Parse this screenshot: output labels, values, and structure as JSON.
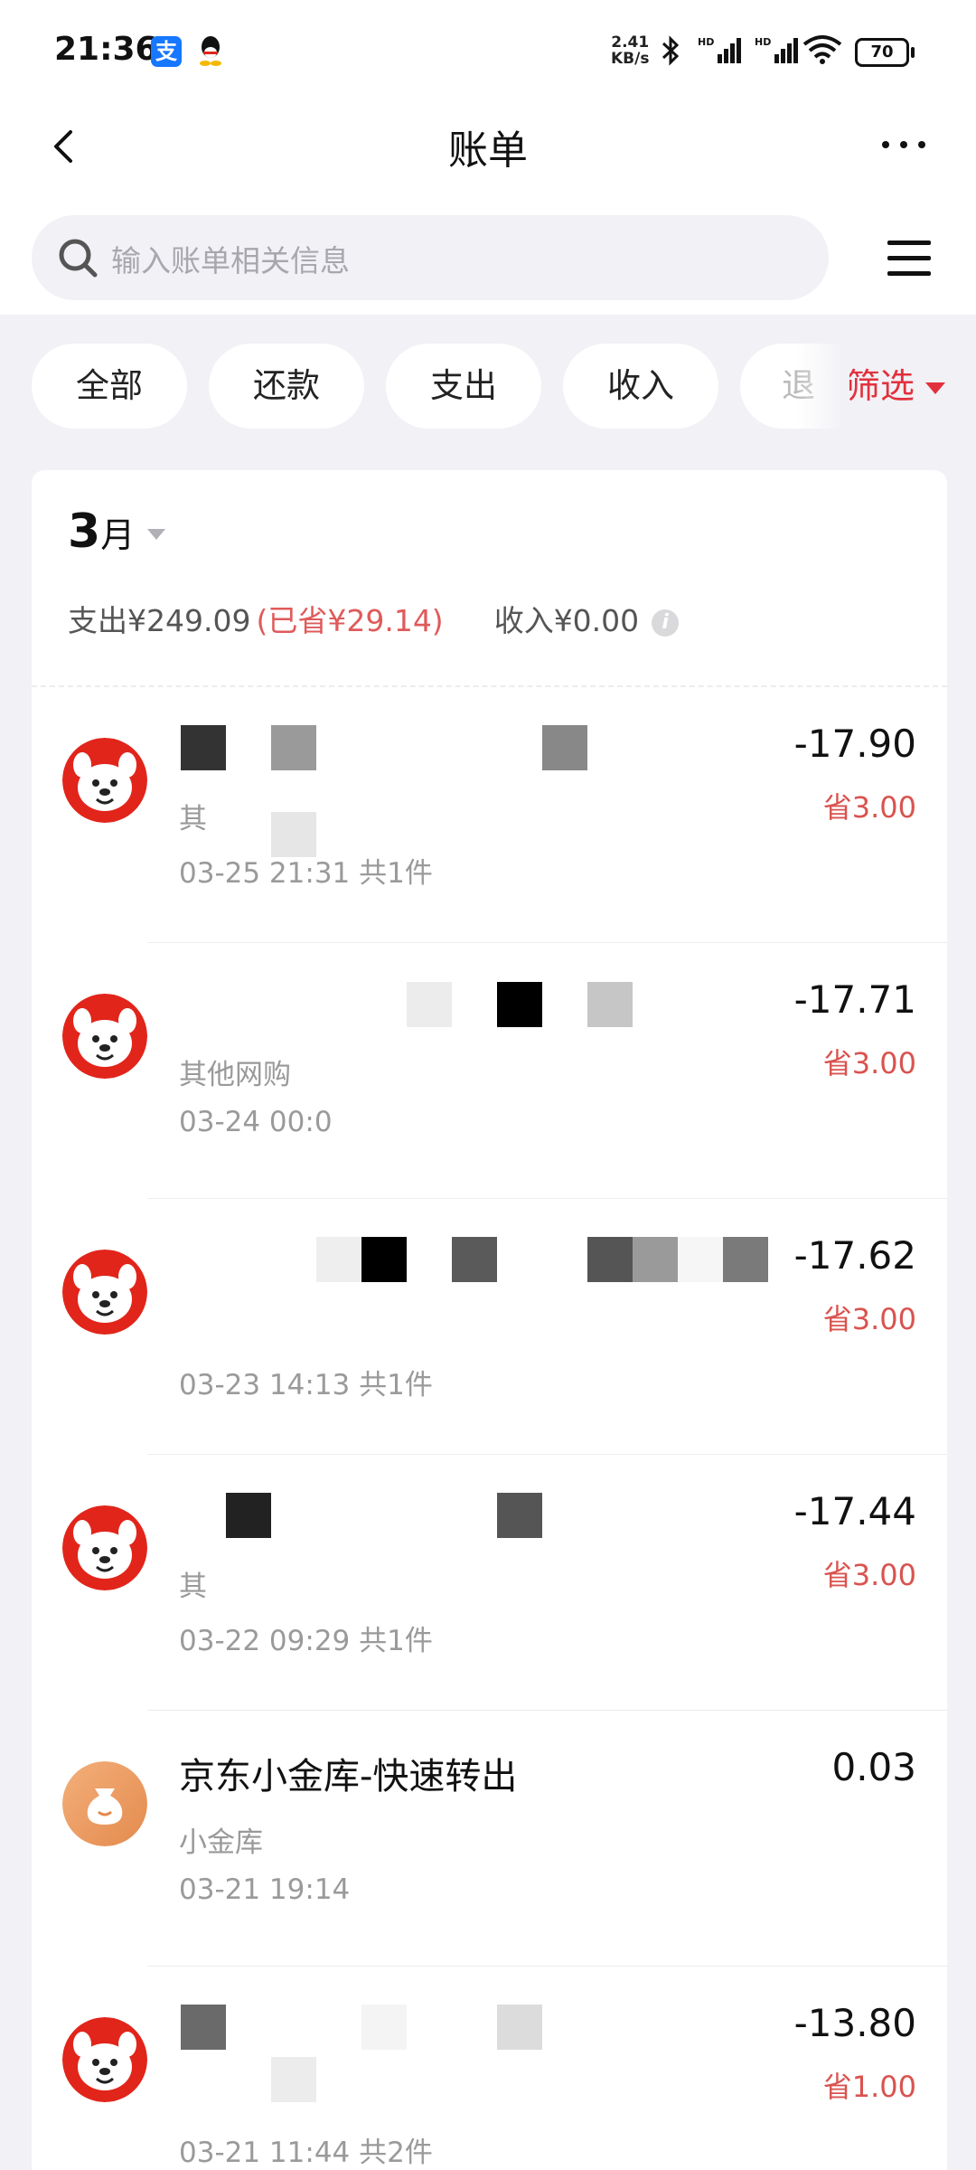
{
  "status_bar": {
    "time": "21:36",
    "app_a_label": "支",
    "net_speed_value": "2.41",
    "net_speed_unit": "KB/s",
    "battery": "70",
    "icons": [
      "alipay-icon",
      "qq-icon",
      "bluetooth-icon",
      "signal-icon",
      "signal-icon",
      "wifi-icon",
      "battery-icon"
    ]
  },
  "nav": {
    "title": "账单"
  },
  "search": {
    "placeholder": "输入账单相关信息"
  },
  "tabs": [
    "全部",
    "还款",
    "支出",
    "收入",
    "退"
  ],
  "filter_label": "筛选",
  "summary": {
    "month": "3",
    "month_unit": "月",
    "expense": "支出¥249.09",
    "saved": "(已省¥29.14)",
    "income": "收入¥0.00"
  },
  "transactions": [
    {
      "name": "",
      "category": "其",
      "date": "03-25 21:31 共1件",
      "amount": "-17.90",
      "saving": "省3.00",
      "avatar": "jd-dog"
    },
    {
      "name": "",
      "category": "其他网购",
      "date": "03-24 00:0",
      "amount": "-17.71",
      "saving": "省3.00",
      "avatar": "jd-dog"
    },
    {
      "name": "",
      "category": "",
      "date": "03-23 14:13 共1件",
      "amount": "-17.62",
      "saving": "省3.00",
      "avatar": "jd-dog"
    },
    {
      "name": "",
      "category": "其",
      "date": "03-22 09:29 共1件",
      "amount": "-17.44",
      "saving": "省3.00",
      "avatar": "jd-dog"
    },
    {
      "name": "京东小金库-快速转出",
      "category": "小金库",
      "date": "03-21 19:14",
      "amount": "0.03",
      "saving": "",
      "avatar": "money-bag"
    },
    {
      "name": "",
      "category": "",
      "date": "03-21 11:44 共2件",
      "amount": "-13.80",
      "saving": "省1.00",
      "avatar": "jd-dog"
    }
  ],
  "colors": {
    "accent_red": "#e2313c",
    "saving_red": "#d9534f",
    "jd_red": "#e1251b",
    "bg": "#f1f1f6"
  }
}
